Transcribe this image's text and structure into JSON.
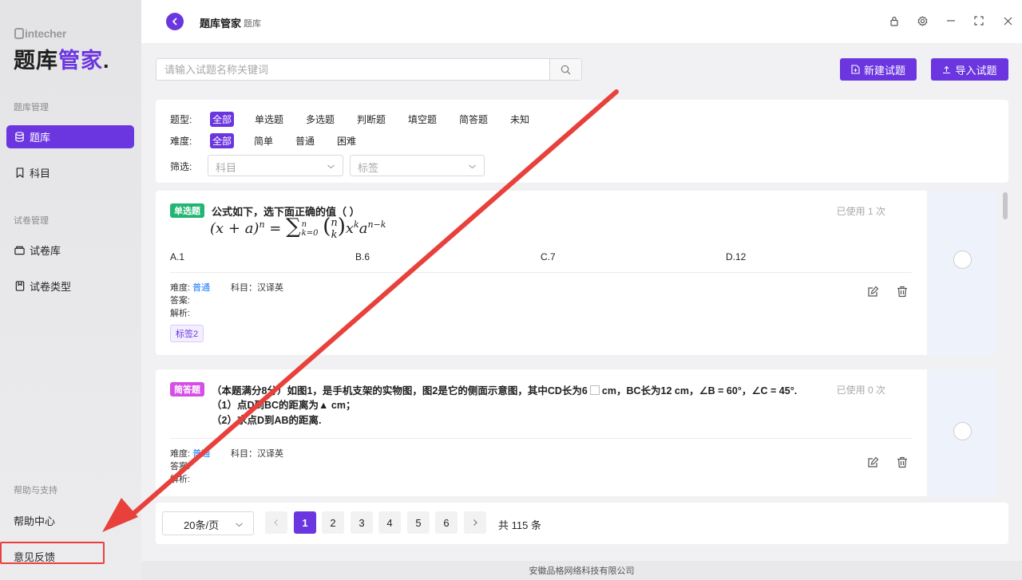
{
  "brand": {
    "small": "intecher",
    "big_part1": "题库",
    "big_part2": "管家",
    "dot": "."
  },
  "sidebar": {
    "section1": "题库管理",
    "items1": [
      {
        "label": "题库"
      },
      {
        "label": "科目"
      }
    ],
    "section2": "试卷管理",
    "items2": [
      {
        "label": "试卷库"
      },
      {
        "label": "试卷类型"
      }
    ],
    "section3": "帮助与支持",
    "help_center": "帮助中心",
    "feedback": "意见反馈"
  },
  "topbar": {
    "title": "题库管家",
    "subtitle": "题库"
  },
  "search": {
    "placeholder": "请输入试题名称关键词"
  },
  "actions": {
    "new": "新建试题",
    "import": "导入试题"
  },
  "filters": {
    "type_label": "题型:",
    "types": [
      "全部",
      "单选题",
      "多选题",
      "判断题",
      "填空题",
      "简答题",
      "未知"
    ],
    "difficulty_label": "难度:",
    "difficulties": [
      "全部",
      "简单",
      "普通",
      "困难"
    ],
    "filter_label": "筛选:",
    "subject_placeholder": "科目",
    "tag_placeholder": "标签"
  },
  "questions": [
    {
      "type": "单选题",
      "type_color": "#22b573",
      "text": "公式如下，选下面正确的值（ ）",
      "used": "已使用 1 次",
      "options": [
        "A.1",
        "B.6",
        "C.7",
        "D.12"
      ],
      "difficulty_label": "难度:",
      "difficulty": "普通",
      "subject": "科目：汉译英",
      "answer": "答案:",
      "analysis": "解析:",
      "tag": "标签2"
    },
    {
      "type": "简答题",
      "type_color": "#d64ee6",
      "line1": "（本题满分8分）如图1，是手机支架的实物图，图2是它的侧面示意图，其中CD长为6",
      "line1b": "cm，BC长为12 cm，∠B = 60°，∠C = 45°.",
      "line2": "（1）点D到BC的距离为▲ cm；",
      "line3": "（2）求点D到AB的距离.",
      "used": "已使用 0 次",
      "difficulty_label": "难度:",
      "difficulty": "普通",
      "subject": "科目：汉译英",
      "answer": "答案:",
      "analysis": "解析:"
    }
  ],
  "pager": {
    "page_size": "20条/页",
    "pages": [
      "1",
      "2",
      "3",
      "4",
      "5",
      "6"
    ],
    "total": "共 115 条"
  },
  "footer": "安徽品格网络科技有限公司",
  "colors": {
    "accent": "#6b35e0",
    "annotation": "#e8413c"
  }
}
